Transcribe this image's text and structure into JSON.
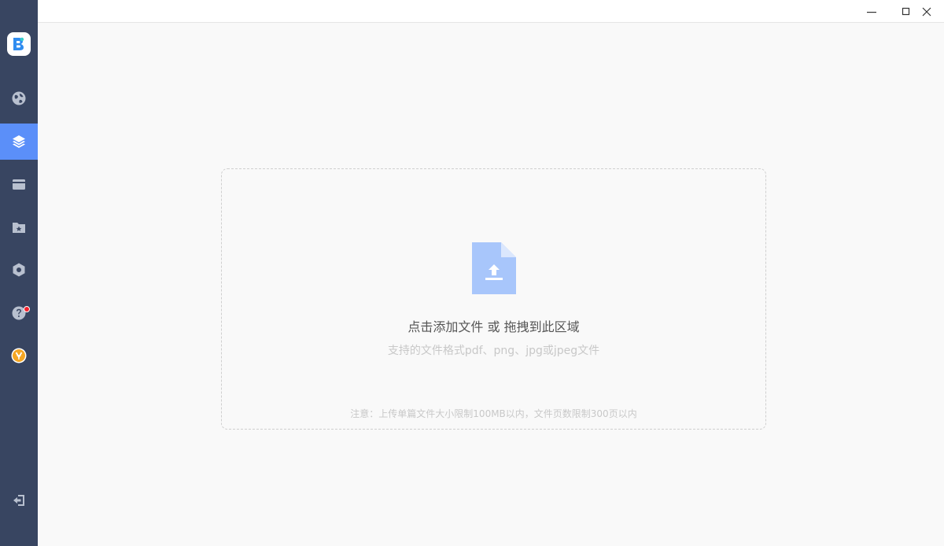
{
  "sidebar": {
    "logo_icon": "app-logo-icon",
    "items": [
      {
        "id": "globe",
        "icon": "globe-icon",
        "active": false
      },
      {
        "id": "layers",
        "icon": "layers-icon",
        "active": true
      },
      {
        "id": "card",
        "icon": "card-icon",
        "active": false
      },
      {
        "id": "folder-star",
        "icon": "folder-star-icon",
        "active": false
      },
      {
        "id": "settings",
        "icon": "hexagon-settings-icon",
        "active": false
      },
      {
        "id": "help",
        "icon": "help-icon",
        "active": false,
        "badge": true
      },
      {
        "id": "vip",
        "icon": "vip-coin-icon",
        "active": false
      }
    ],
    "logout_icon": "logout-icon"
  },
  "window_controls": [
    "minimize-icon",
    "maximize-icon",
    "close-icon"
  ],
  "dropzone": {
    "main_text": "点击添加文件 或 拖拽到此区域",
    "sub_text": "支持的文件格式pdf、png、jpg或jpeg文件",
    "note_text": "注意：上传单篇文件大小限制100MB以内，文件页数限制300页以内"
  },
  "colors": {
    "sidebar_bg": "#384561",
    "active_bg": "#5b8ff9",
    "icon_color": "#b8c0cf",
    "upload_icon": "#a8c6fb",
    "badge": "#f5222d",
    "vip": "#f5a623"
  }
}
